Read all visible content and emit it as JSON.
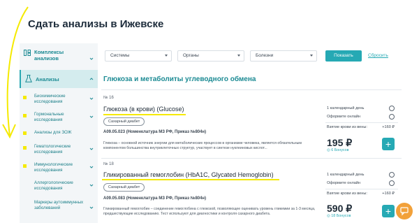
{
  "page": {
    "title": "Сдать анализы в Ижевске"
  },
  "sidebar": {
    "items": [
      {
        "label": "Комплексы анализов",
        "icon": "grid-icon"
      },
      {
        "label": "Анализы",
        "icon": "flask-icon"
      }
    ],
    "subitems": [
      {
        "label": "Биохимические исследования"
      },
      {
        "label": "Гормональные исследования"
      },
      {
        "label": "Анализы для ЗОЖ"
      },
      {
        "label": "Гематологические исследования"
      },
      {
        "label": "Иммунологические исследования"
      },
      {
        "label": "Аллергологические исследования"
      },
      {
        "label": "Маркеры аутоиммунных заболеваний"
      }
    ]
  },
  "filters": {
    "systems": "Системы",
    "organs": "Органы",
    "diseases": "Болезни",
    "show_label": "Показать",
    "reset_label": "Сбросить"
  },
  "section": {
    "title": "Глюкоза и метаболиты углеводного обмена"
  },
  "cards": [
    {
      "number": "№ 16",
      "title": "Глюкоза (в крови) (Glucose)",
      "tag": "Сахарный диабет",
      "code": "A09.05.023 (Номенклатура МЗ РФ, Приказ №804н)",
      "description": "Глюкоза – основной источник энергии для метаболических процессов в организме человека, является обязательным компонентом большинства внутриклеточных структур, участвует в синтезе нуклеиновых кислот...",
      "duration": "1 календарный день",
      "online": "Оформите онлайн",
      "blood_label": "Взятие крови из вены:",
      "blood_price": "+160 ₽",
      "price": "195 ₽",
      "bonus": "◎ 6 Бонусов"
    },
    {
      "number": "№ 18",
      "title": "Гликированный гемоглобин (HbA1C, Glycated Hemoglobin)",
      "tag": "Сахарный диабет",
      "code": "A09.05.083 (Номенклатура МЗ РФ, Приказ №804н)",
      "description": "Гликированный гемоглобин – соединение гемоглобина с глюкозой, позволяющее оценивать уровень гликемии за 1-3 месяца, предшествующие исследованию. Тест используют для диагностики и контроля сахарного диабета.",
      "duration": "1 календарный день",
      "online": "Оформите онлайн",
      "blood_label": "Взятие крови из вены:",
      "blood_price": "+160 ₽",
      "price": "590 ₽",
      "bonus": "◎ 18 Бонусов"
    }
  ],
  "colors": {
    "accent": "#26a9b4",
    "highlight": "#f5ea00",
    "chat": "#f2a13a"
  }
}
